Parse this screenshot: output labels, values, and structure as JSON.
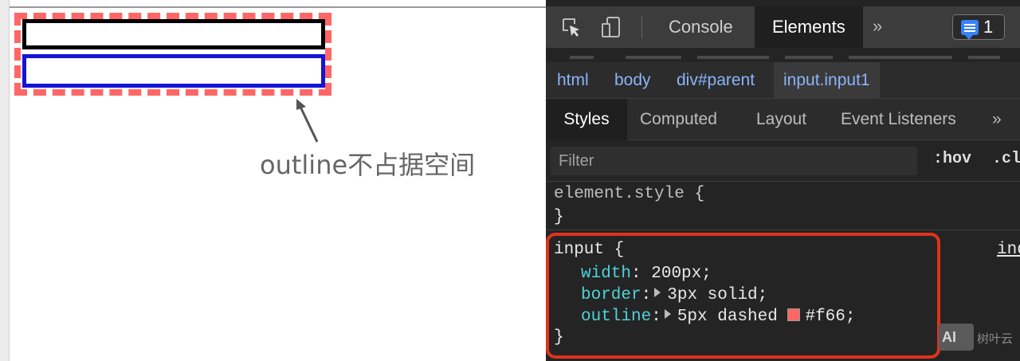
{
  "page": {
    "annotation": "outline不占据空间"
  },
  "devtools": {
    "toolbar": {
      "tabs": [
        "Console",
        "Elements"
      ],
      "active_tab": "Elements",
      "more": "»",
      "message_count": "1"
    },
    "breadcrumb": [
      "html",
      "body",
      "div#parent",
      "input.input1"
    ],
    "subtabs": [
      "Styles",
      "Computed",
      "Layout",
      "Event Listeners"
    ],
    "subtabs_more": "»",
    "filter": {
      "placeholder": "Filter",
      "hov": ":hov",
      "cls": ".cl"
    },
    "element_style": {
      "selector": "element.style",
      "open": "{",
      "close": "}"
    },
    "rule": {
      "selector": "input",
      "open": "{",
      "close": "}",
      "source": "ind",
      "declarations": [
        {
          "property": "width",
          "value": "200px;"
        },
        {
          "property": "border",
          "value": "3px solid;"
        },
        {
          "property": "outline",
          "value": "5px dashed",
          "color": "#f66;"
        }
      ]
    }
  },
  "colors": {
    "outline": "#f66",
    "input1_border": "#000000",
    "input2_border": "#1414d6",
    "highlight": "#e0321c",
    "css_property": "#4fd1d9",
    "devtools_link": "#8ab4f8"
  },
  "watermark": {
    "logo": "AI",
    "text": "树叶云"
  }
}
